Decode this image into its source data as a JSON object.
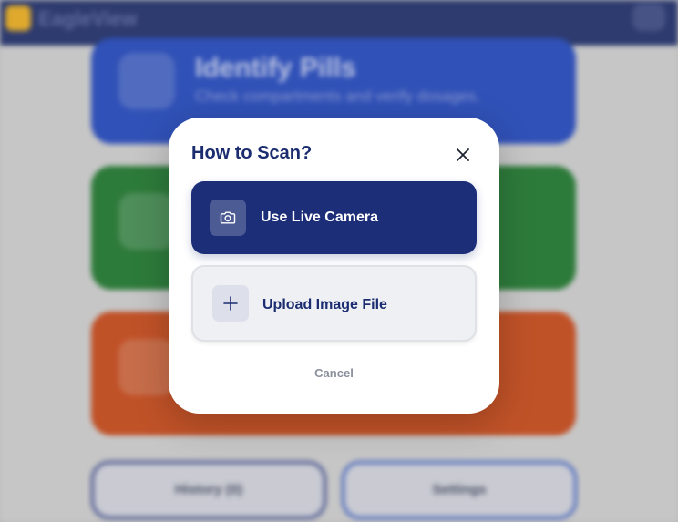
{
  "background": {
    "app_name": "EagleView",
    "cards": [
      {
        "title": "Identify Pills",
        "subtitle": "Check compartments and verify dosages."
      }
    ],
    "bottom": {
      "history_label": "History (0)",
      "settings_label": "Settings"
    }
  },
  "modal": {
    "title": "How to Scan?",
    "options": [
      {
        "label": "Use Live Camera",
        "icon": "camera-icon"
      },
      {
        "label": "Upload Image File",
        "icon": "plus-icon"
      }
    ],
    "cancel_label": "Cancel"
  },
  "colors": {
    "primary": "#1c2e78",
    "title": "#1b2d70",
    "blue_card": "#1f47c4",
    "green_card": "#1c7a2c",
    "orange_card": "#cf4815",
    "brand": "#f3b21b"
  }
}
